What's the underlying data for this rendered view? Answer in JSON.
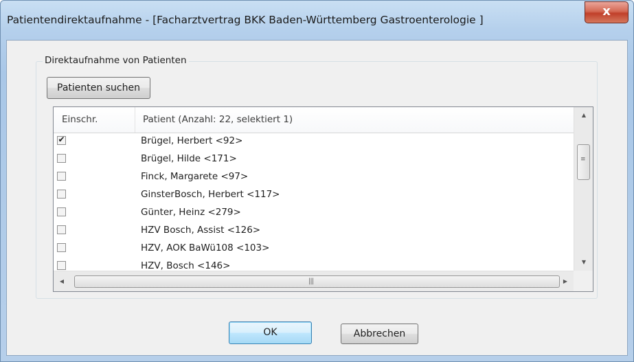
{
  "window": {
    "title": "Patientendirektaufnahme - [Facharztvertrag BKK Baden-Württemberg Gastroenterologie ]",
    "close_label": "x"
  },
  "group": {
    "label": "Direktaufnahme von Patienten",
    "search_button": "Patienten suchen"
  },
  "list": {
    "columns": [
      "Einschr.",
      "Patient (Anzahl: 22, selektiert 1)"
    ],
    "rows": [
      {
        "checked": true,
        "checkmark": "✔",
        "name": "Brügel,  Herbert <92>"
      },
      {
        "checked": false,
        "checkmark": "",
        "name": "Brügel,  Hilde <171>"
      },
      {
        "checked": false,
        "checkmark": "",
        "name": "Finck,  Margarete <97>"
      },
      {
        "checked": false,
        "checkmark": "",
        "name": "GinsterBosch,  Herbert <117>"
      },
      {
        "checked": false,
        "checkmark": "",
        "name": "Günter,  Heinz <279>"
      },
      {
        "checked": false,
        "checkmark": "",
        "name": "HZV Bosch,  Assist <126>"
      },
      {
        "checked": false,
        "checkmark": "",
        "name": "HZV,  AOK BaWü108 <103>"
      },
      {
        "checked": false,
        "checkmark": "",
        "name": "HZV,  Bosch <146>"
      }
    ]
  },
  "footer": {
    "ok_label": "OK",
    "cancel_label": "Abbrechen"
  }
}
